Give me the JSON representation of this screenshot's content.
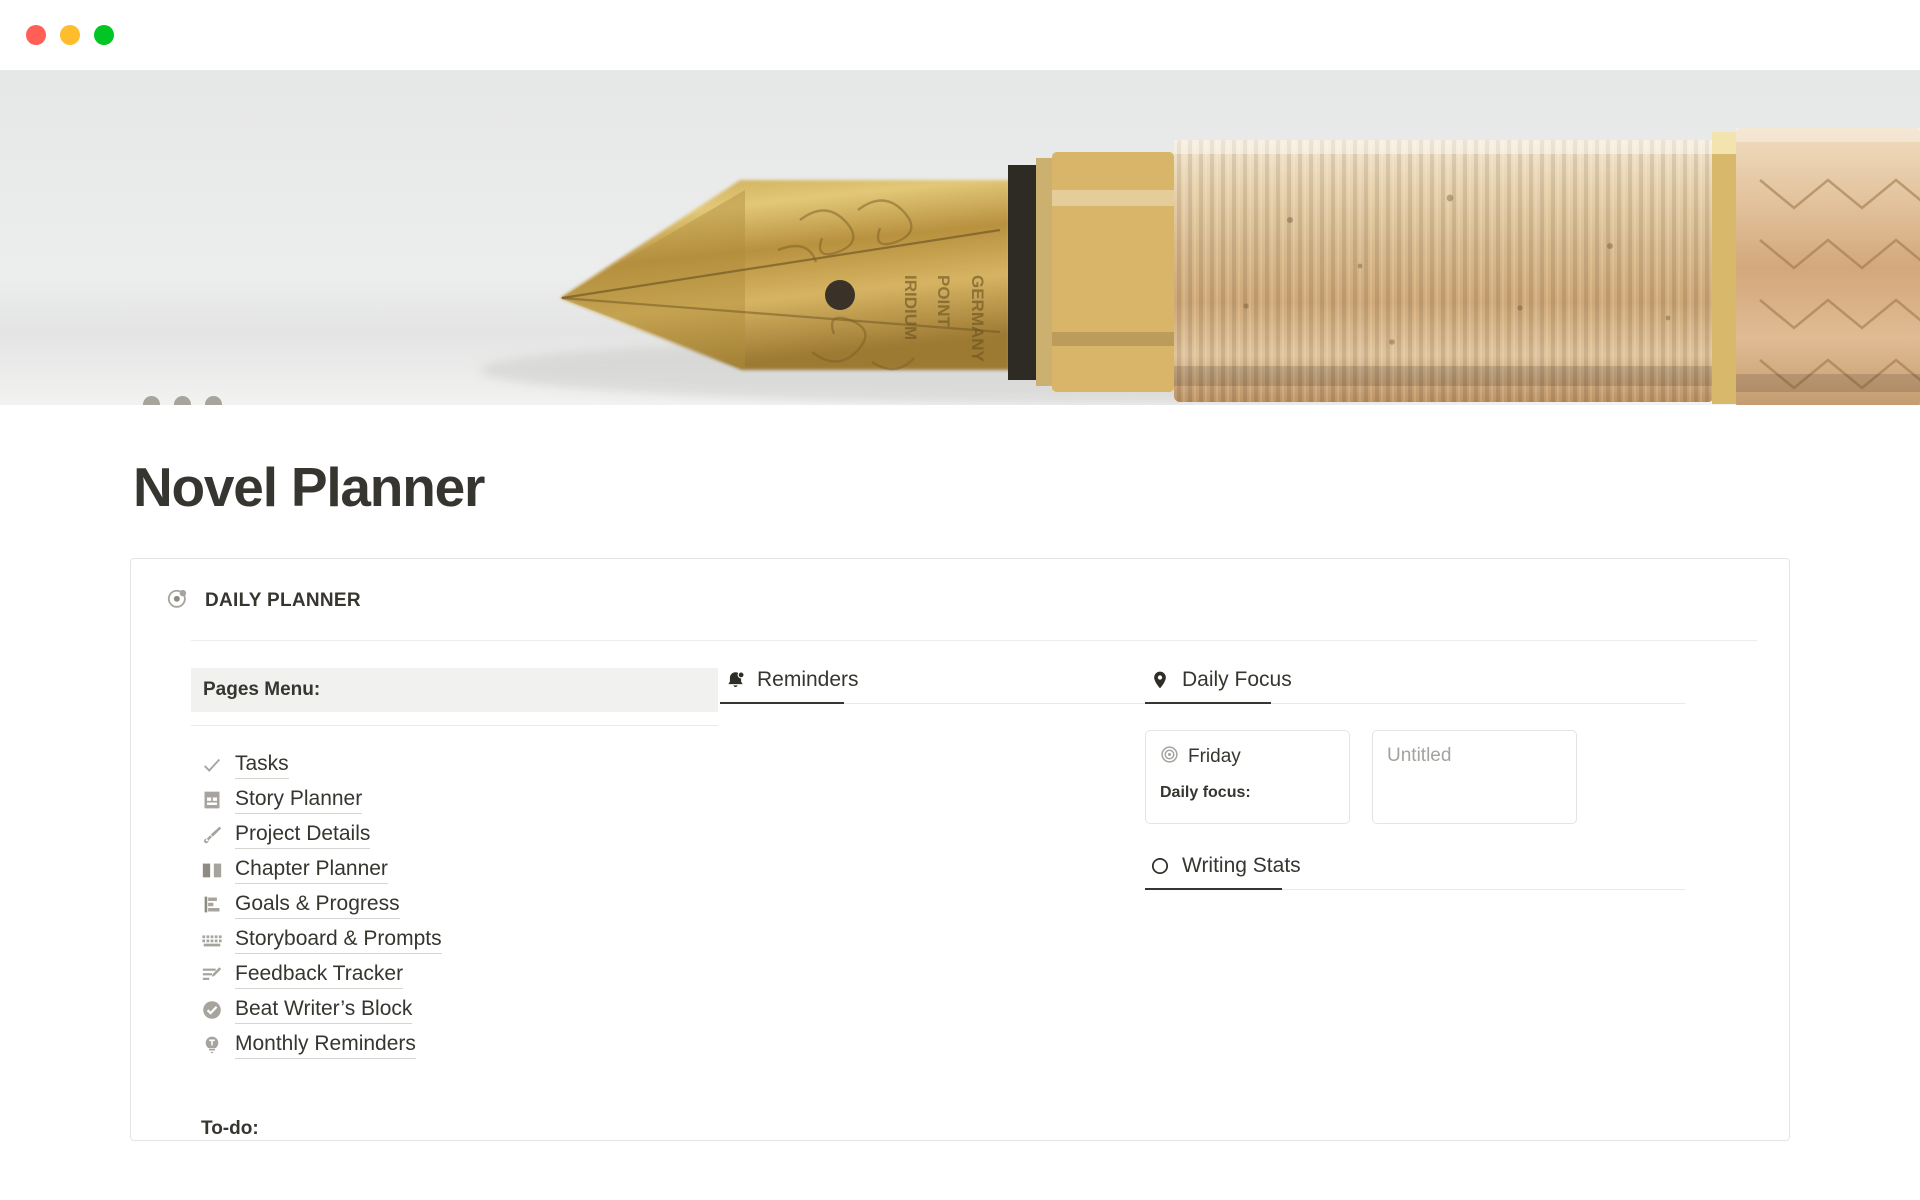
{
  "window": {
    "buttons": [
      {
        "name": "close",
        "color": "#ff5f57"
      },
      {
        "name": "minimize",
        "color": "#ffbd2e"
      },
      {
        "name": "maximize",
        "color": "#00c524"
      }
    ]
  },
  "hero": {
    "alt": "fountain-pen-nib-cover-image",
    "carousel_dots": 3,
    "dot_color": "#a7a49e"
  },
  "page": {
    "title": "Novel Planner"
  },
  "planner": {
    "header": {
      "icon": "target-dot-icon",
      "label": "DAILY PLANNER"
    },
    "pages_menu": {
      "heading": "Pages Menu:",
      "items": [
        {
          "icon": "check-icon",
          "label": "Tasks"
        },
        {
          "icon": "notepad-icon",
          "label": "Story Planner"
        },
        {
          "icon": "paintbrush-icon",
          "label": "Project Details"
        },
        {
          "icon": "open-book-icon",
          "label": "Chapter Planner"
        },
        {
          "icon": "bar-chart-icon",
          "label": "Goals & Progress"
        },
        {
          "icon": "keyboard-icon",
          "label": "Storyboard & Prompts"
        },
        {
          "icon": "edit-list-icon",
          "label": "Feedback Tracker"
        },
        {
          "icon": "check-circle-icon",
          "label": "Beat Writer’s Block"
        },
        {
          "icon": "lightbulb-icon",
          "label": "Monthly Reminders"
        }
      ],
      "todo_heading": "To-do:"
    },
    "reminders_tab": {
      "icon": "bell-notification-icon",
      "label": "Reminders",
      "active": true
    },
    "daily_focus_tab": {
      "icon": "map-pin-icon",
      "label": "Daily Focus",
      "active": true
    },
    "focus_cards": [
      {
        "icon": "bullseye-icon",
        "title": "Friday",
        "subtitle": "Daily focus:",
        "placeholder": ""
      },
      {
        "icon": "",
        "title": "",
        "subtitle": "",
        "placeholder": "Untitled"
      }
    ],
    "writing_stats_tab": {
      "icon": "circle-outline-icon",
      "label": "Writing Stats",
      "active": true
    }
  },
  "colors": {
    "text_primary": "#37352f",
    "icon_gray": "#a7a49e",
    "rule": "#e9e9e7",
    "card_border": "#e4e4e2",
    "menu_highlight": "#f1f1ef",
    "placeholder": "#a5a39e"
  }
}
